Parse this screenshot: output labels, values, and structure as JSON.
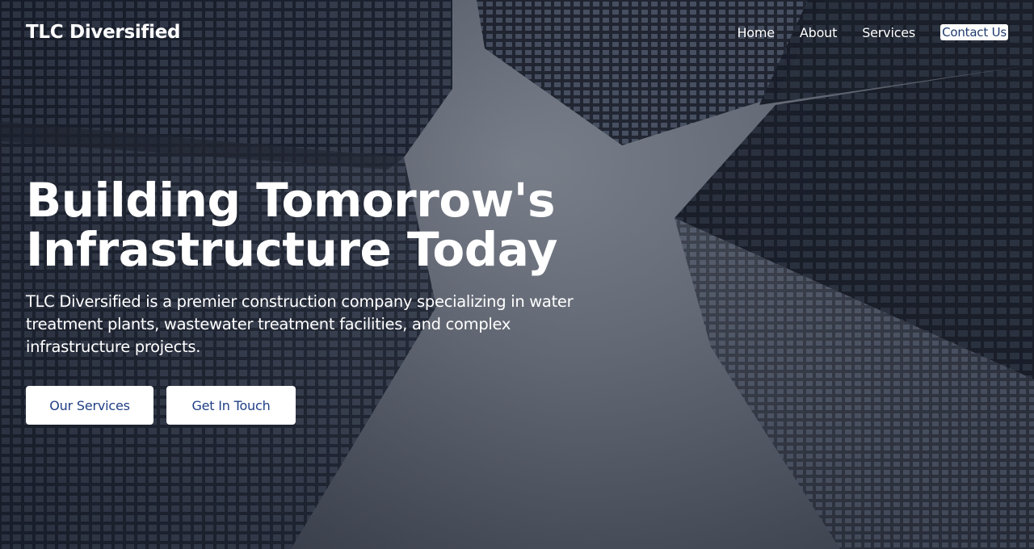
{
  "brand": {
    "name": "TLC Diversified"
  },
  "nav": {
    "items": [
      {
        "label": "Home"
      },
      {
        "label": "About"
      },
      {
        "label": "Services"
      },
      {
        "label": "Contact Us"
      }
    ]
  },
  "hero": {
    "headline_line1": "Building Tomorrow's",
    "headline_line2": "Infrastructure Today",
    "tagline": "TLC Diversified is a premier construction company specializing in water treatment plants, wastewater treatment facilities, and complex infrastructure projects.",
    "primary_button": "Our Services",
    "secondary_button": "Get In Touch"
  },
  "colors": {
    "accent": "#1f3f86",
    "text_on_dark": "#ffffff",
    "button_bg": "#ffffff"
  }
}
